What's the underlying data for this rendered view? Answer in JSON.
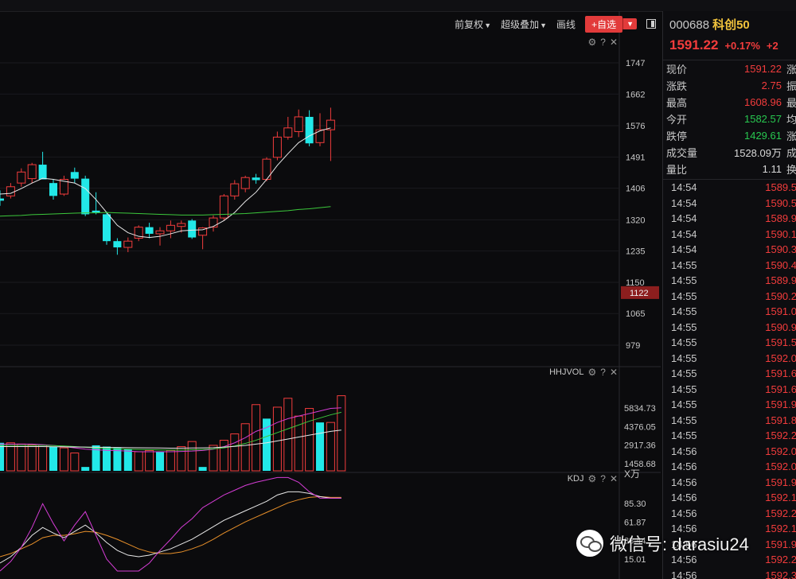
{
  "toolbar": {
    "adjust_label": "前复权",
    "overlay_label": "超级叠加",
    "draw_label": "画线",
    "add_fav_label": "+自选"
  },
  "indicators": {
    "volume_name": "HHJVOL",
    "kdj_name": "KDJ"
  },
  "axis": {
    "price_ticks": [
      "1747",
      "1662",
      "1576",
      "1491",
      "1406",
      "1320",
      "1235",
      "1150",
      "1065",
      "979"
    ],
    "price_highlight": "1122",
    "volume_ticks": [
      "5834.73",
      "4376.05",
      "2917.36",
      "1458.68"
    ],
    "volume_unit": "X万",
    "kdj_ticks": [
      "85.30",
      "61.87",
      "38.44",
      "15.01"
    ]
  },
  "quote": {
    "code": "000688",
    "name": "科创50",
    "price": "1591.22",
    "change_pct": "+0.17%",
    "change_pct_more": "+2",
    "rows": [
      {
        "label": "现价",
        "value": "1591.22",
        "tail": "涨",
        "color": "red"
      },
      {
        "label": "涨跌",
        "value": "2.75",
        "tail": "振",
        "color": "red"
      },
      {
        "label": "最高",
        "value": "1608.96",
        "tail": "最",
        "color": "red"
      },
      {
        "label": "今开",
        "value": "1582.57",
        "tail": "均",
        "color": "green"
      },
      {
        "label": "跌停",
        "value": "1429.61",
        "tail": "涨",
        "color": "green"
      },
      {
        "label": "成交量",
        "value": "1528.09万",
        "tail": "成",
        "color": "white"
      },
      {
        "label": "量比",
        "value": "1.11",
        "tail": "换",
        "color": "white"
      }
    ]
  },
  "ticks": [
    {
      "time": "14:54",
      "price": "1589.5"
    },
    {
      "time": "14:54",
      "price": "1590.5"
    },
    {
      "time": "14:54",
      "price": "1589.9"
    },
    {
      "time": "14:54",
      "price": "1590.1"
    },
    {
      "time": "14:54",
      "price": "1590.3"
    },
    {
      "time": "14:55",
      "price": "1590.4"
    },
    {
      "time": "14:55",
      "price": "1589.9"
    },
    {
      "time": "14:55",
      "price": "1590.2"
    },
    {
      "time": "14:55",
      "price": "1591.0"
    },
    {
      "time": "14:55",
      "price": "1590.9"
    },
    {
      "time": "14:55",
      "price": "1591.5"
    },
    {
      "time": "14:55",
      "price": "1592.0"
    },
    {
      "time": "14:55",
      "price": "1591.6"
    },
    {
      "time": "14:55",
      "price": "1591.6"
    },
    {
      "time": "14:55",
      "price": "1591.9"
    },
    {
      "time": "14:55",
      "price": "1591.8"
    },
    {
      "time": "14:55",
      "price": "1592.2"
    },
    {
      "time": "14:56",
      "price": "1592.0"
    },
    {
      "time": "14:56",
      "price": "1592.0"
    },
    {
      "time": "14:56",
      "price": "1591.9"
    },
    {
      "time": "14:56",
      "price": "1592.1"
    },
    {
      "time": "14:56",
      "price": "1592.2"
    },
    {
      "time": "14:56",
      "price": "1592.1"
    },
    {
      "time": "14:56",
      "price": "1591.9"
    },
    {
      "time": "14:56",
      "price": "1592.2"
    },
    {
      "time": "14:56",
      "price": "1592.3"
    }
  ],
  "watermark": {
    "text": "微信号: darasiu24"
  },
  "colors": {
    "up": "#f23c3c",
    "down": "#22e8e8",
    "ma5": "#e8e8e8",
    "ma_long": "#3cc83c",
    "k_line": "#e8e8e8",
    "d_line": "#e8902a",
    "j_line": "#d43cd4"
  },
  "chart_data": {
    "type": "candlestick",
    "price_axis_ticks": [
      1747,
      1662,
      1576,
      1491,
      1406,
      1320,
      1235,
      1150,
      1065,
      979
    ],
    "candles": [
      {
        "o": 1378,
        "h": 1400,
        "l": 1358,
        "c": 1372,
        "up": false
      },
      {
        "o": 1385,
        "h": 1420,
        "l": 1378,
        "c": 1410,
        "up": true
      },
      {
        "o": 1420,
        "h": 1460,
        "l": 1410,
        "c": 1450,
        "up": true
      },
      {
        "o": 1432,
        "h": 1475,
        "l": 1420,
        "c": 1470,
        "up": true
      },
      {
        "o": 1470,
        "h": 1505,
        "l": 1462,
        "c": 1430,
        "up": false
      },
      {
        "o": 1420,
        "h": 1430,
        "l": 1375,
        "c": 1385,
        "up": false
      },
      {
        "o": 1390,
        "h": 1440,
        "l": 1385,
        "c": 1430,
        "up": true
      },
      {
        "o": 1450,
        "h": 1462,
        "l": 1420,
        "c": 1432,
        "up": false
      },
      {
        "o": 1432,
        "h": 1440,
        "l": 1330,
        "c": 1335,
        "up": false
      },
      {
        "o": 1345,
        "h": 1395,
        "l": 1335,
        "c": 1340,
        "up": false
      },
      {
        "o": 1335,
        "h": 1342,
        "l": 1252,
        "c": 1262,
        "up": false
      },
      {
        "o": 1262,
        "h": 1270,
        "l": 1225,
        "c": 1245,
        "up": false
      },
      {
        "o": 1245,
        "h": 1272,
        "l": 1232,
        "c": 1262,
        "up": true
      },
      {
        "o": 1270,
        "h": 1305,
        "l": 1262,
        "c": 1300,
        "up": true
      },
      {
        "o": 1300,
        "h": 1312,
        "l": 1270,
        "c": 1282,
        "up": false
      },
      {
        "o": 1282,
        "h": 1300,
        "l": 1250,
        "c": 1290,
        "up": true
      },
      {
        "o": 1290,
        "h": 1318,
        "l": 1270,
        "c": 1305,
        "up": true
      },
      {
        "o": 1302,
        "h": 1318,
        "l": 1285,
        "c": 1310,
        "up": true
      },
      {
        "o": 1318,
        "h": 1322,
        "l": 1268,
        "c": 1272,
        "up": false
      },
      {
        "o": 1278,
        "h": 1300,
        "l": 1240,
        "c": 1298,
        "up": true
      },
      {
        "o": 1300,
        "h": 1332,
        "l": 1288,
        "c": 1325,
        "up": true
      },
      {
        "o": 1325,
        "h": 1390,
        "l": 1318,
        "c": 1385,
        "up": true
      },
      {
        "o": 1385,
        "h": 1428,
        "l": 1375,
        "c": 1418,
        "up": true
      },
      {
        "o": 1405,
        "h": 1440,
        "l": 1395,
        "c": 1435,
        "up": true
      },
      {
        "o": 1435,
        "h": 1445,
        "l": 1418,
        "c": 1428,
        "up": false
      },
      {
        "o": 1430,
        "h": 1490,
        "l": 1425,
        "c": 1485,
        "up": true
      },
      {
        "o": 1490,
        "h": 1560,
        "l": 1482,
        "c": 1545,
        "up": true
      },
      {
        "o": 1545,
        "h": 1600,
        "l": 1538,
        "c": 1570,
        "up": true
      },
      {
        "o": 1560,
        "h": 1620,
        "l": 1545,
        "c": 1600,
        "up": true
      },
      {
        "o": 1600,
        "h": 1618,
        "l": 1520,
        "c": 1528,
        "up": false
      },
      {
        "o": 1530,
        "h": 1610,
        "l": 1520,
        "c": 1565,
        "up": true
      },
      {
        "o": 1565,
        "h": 1625,
        "l": 1480,
        "c": 1591,
        "up": true
      }
    ],
    "ma5": [
      1390,
      1392,
      1405,
      1420,
      1433,
      1430,
      1425,
      1420,
      1405,
      1375,
      1340,
      1305,
      1285,
      1275,
      1272,
      1275,
      1282,
      1290,
      1292,
      1293,
      1302,
      1318,
      1340,
      1370,
      1395,
      1430,
      1468,
      1500,
      1530,
      1548,
      1562,
      1570
    ],
    "ma_long": [
      1330,
      1331,
      1332,
      1334,
      1335,
      1336,
      1337,
      1338,
      1339,
      1339,
      1340,
      1339,
      1338,
      1337,
      1336,
      1335,
      1334,
      1333,
      1333,
      1333,
      1334,
      1335,
      1336,
      1337,
      1339,
      1341,
      1343,
      1345,
      1348,
      1350,
      1353,
      1356
    ],
    "volume": [
      {
        "v": 3100,
        "up": false
      },
      {
        "v": 3100,
        "up": true
      },
      {
        "v": 3000,
        "up": true
      },
      {
        "v": 2950,
        "up": true
      },
      {
        "v": 2900,
        "up": true
      },
      {
        "v": 2800,
        "up": false
      },
      {
        "v": 2700,
        "up": true
      },
      {
        "v": 2300,
        "up": true
      },
      {
        "v": 1200,
        "up": false
      },
      {
        "v": 2900,
        "up": false
      },
      {
        "v": 2800,
        "up": false
      },
      {
        "v": 2700,
        "up": false
      },
      {
        "v": 2600,
        "up": false
      },
      {
        "v": 2400,
        "up": true
      },
      {
        "v": 2500,
        "up": true
      },
      {
        "v": 2400,
        "up": false
      },
      {
        "v": 2500,
        "up": true
      },
      {
        "v": 2800,
        "up": true
      },
      {
        "v": 3200,
        "up": true
      },
      {
        "v": 1200,
        "up": false
      },
      {
        "v": 2900,
        "up": true
      },
      {
        "v": 3300,
        "up": true
      },
      {
        "v": 3800,
        "up": true
      },
      {
        "v": 4600,
        "up": true
      },
      {
        "v": 6100,
        "up": true
      },
      {
        "v": 5000,
        "up": false
      },
      {
        "v": 5900,
        "up": true
      },
      {
        "v": 6600,
        "up": true
      },
      {
        "v": 5200,
        "up": true
      },
      {
        "v": 5800,
        "up": true
      },
      {
        "v": 4700,
        "up": false
      },
      {
        "v": 4700,
        "up": true
      },
      {
        "v": 6800,
        "up": true
      }
    ],
    "vol_ma1": [
      3000,
      3000,
      3000,
      3000,
      2950,
      2900,
      2800,
      2700,
      2600,
      2550,
      2500,
      2480,
      2450,
      2400,
      2400,
      2400,
      2400,
      2420,
      2450,
      2500,
      2600,
      2800,
      3100,
      3500,
      4000,
      4300,
      4700,
      5000,
      5200,
      5400,
      5600,
      5800,
      5850
    ],
    "vol_ma2": [
      2900,
      2900,
      2900,
      2900,
      2900,
      2880,
      2850,
      2800,
      2750,
      2700,
      2650,
      2620,
      2600,
      2580,
      2560,
      2540,
      2530,
      2530,
      2550,
      2580,
      2620,
      2700,
      2850,
      3050,
      3300,
      3600,
      3900,
      4200,
      4500,
      4800,
      5050,
      5300,
      5500
    ],
    "vol_ma3": [
      2800,
      2800,
      2800,
      2800,
      2800,
      2790,
      2780,
      2770,
      2760,
      2750,
      2740,
      2730,
      2720,
      2710,
      2700,
      2690,
      2680,
      2680,
      2690,
      2700,
      2720,
      2760,
      2820,
      2900,
      3000,
      3100,
      3250,
      3400,
      3550,
      3700,
      3850,
      4000,
      4100
    ],
    "kdj_k": [
      10,
      18,
      30,
      45,
      55,
      48,
      42,
      50,
      58,
      48,
      36,
      26,
      20,
      18,
      20,
      24,
      28,
      34,
      40,
      48,
      56,
      64,
      70,
      76,
      82,
      88,
      96,
      100,
      100,
      98,
      94,
      92,
      92
    ],
    "kdj_d": [
      18,
      22,
      28,
      34,
      42,
      45,
      45,
      47,
      50,
      49,
      45,
      40,
      34,
      28,
      24,
      22,
      22,
      24,
      28,
      33,
      40,
      48,
      55,
      62,
      68,
      74,
      80,
      86,
      90,
      93,
      94,
      93,
      93
    ],
    "kdj_j": [
      0,
      12,
      30,
      55,
      85,
      60,
      38,
      58,
      75,
      45,
      15,
      0,
      0,
      0,
      10,
      26,
      40,
      55,
      66,
      80,
      88,
      96,
      102,
      108,
      112,
      115,
      118,
      118,
      112,
      100,
      92,
      92,
      92
    ]
  }
}
